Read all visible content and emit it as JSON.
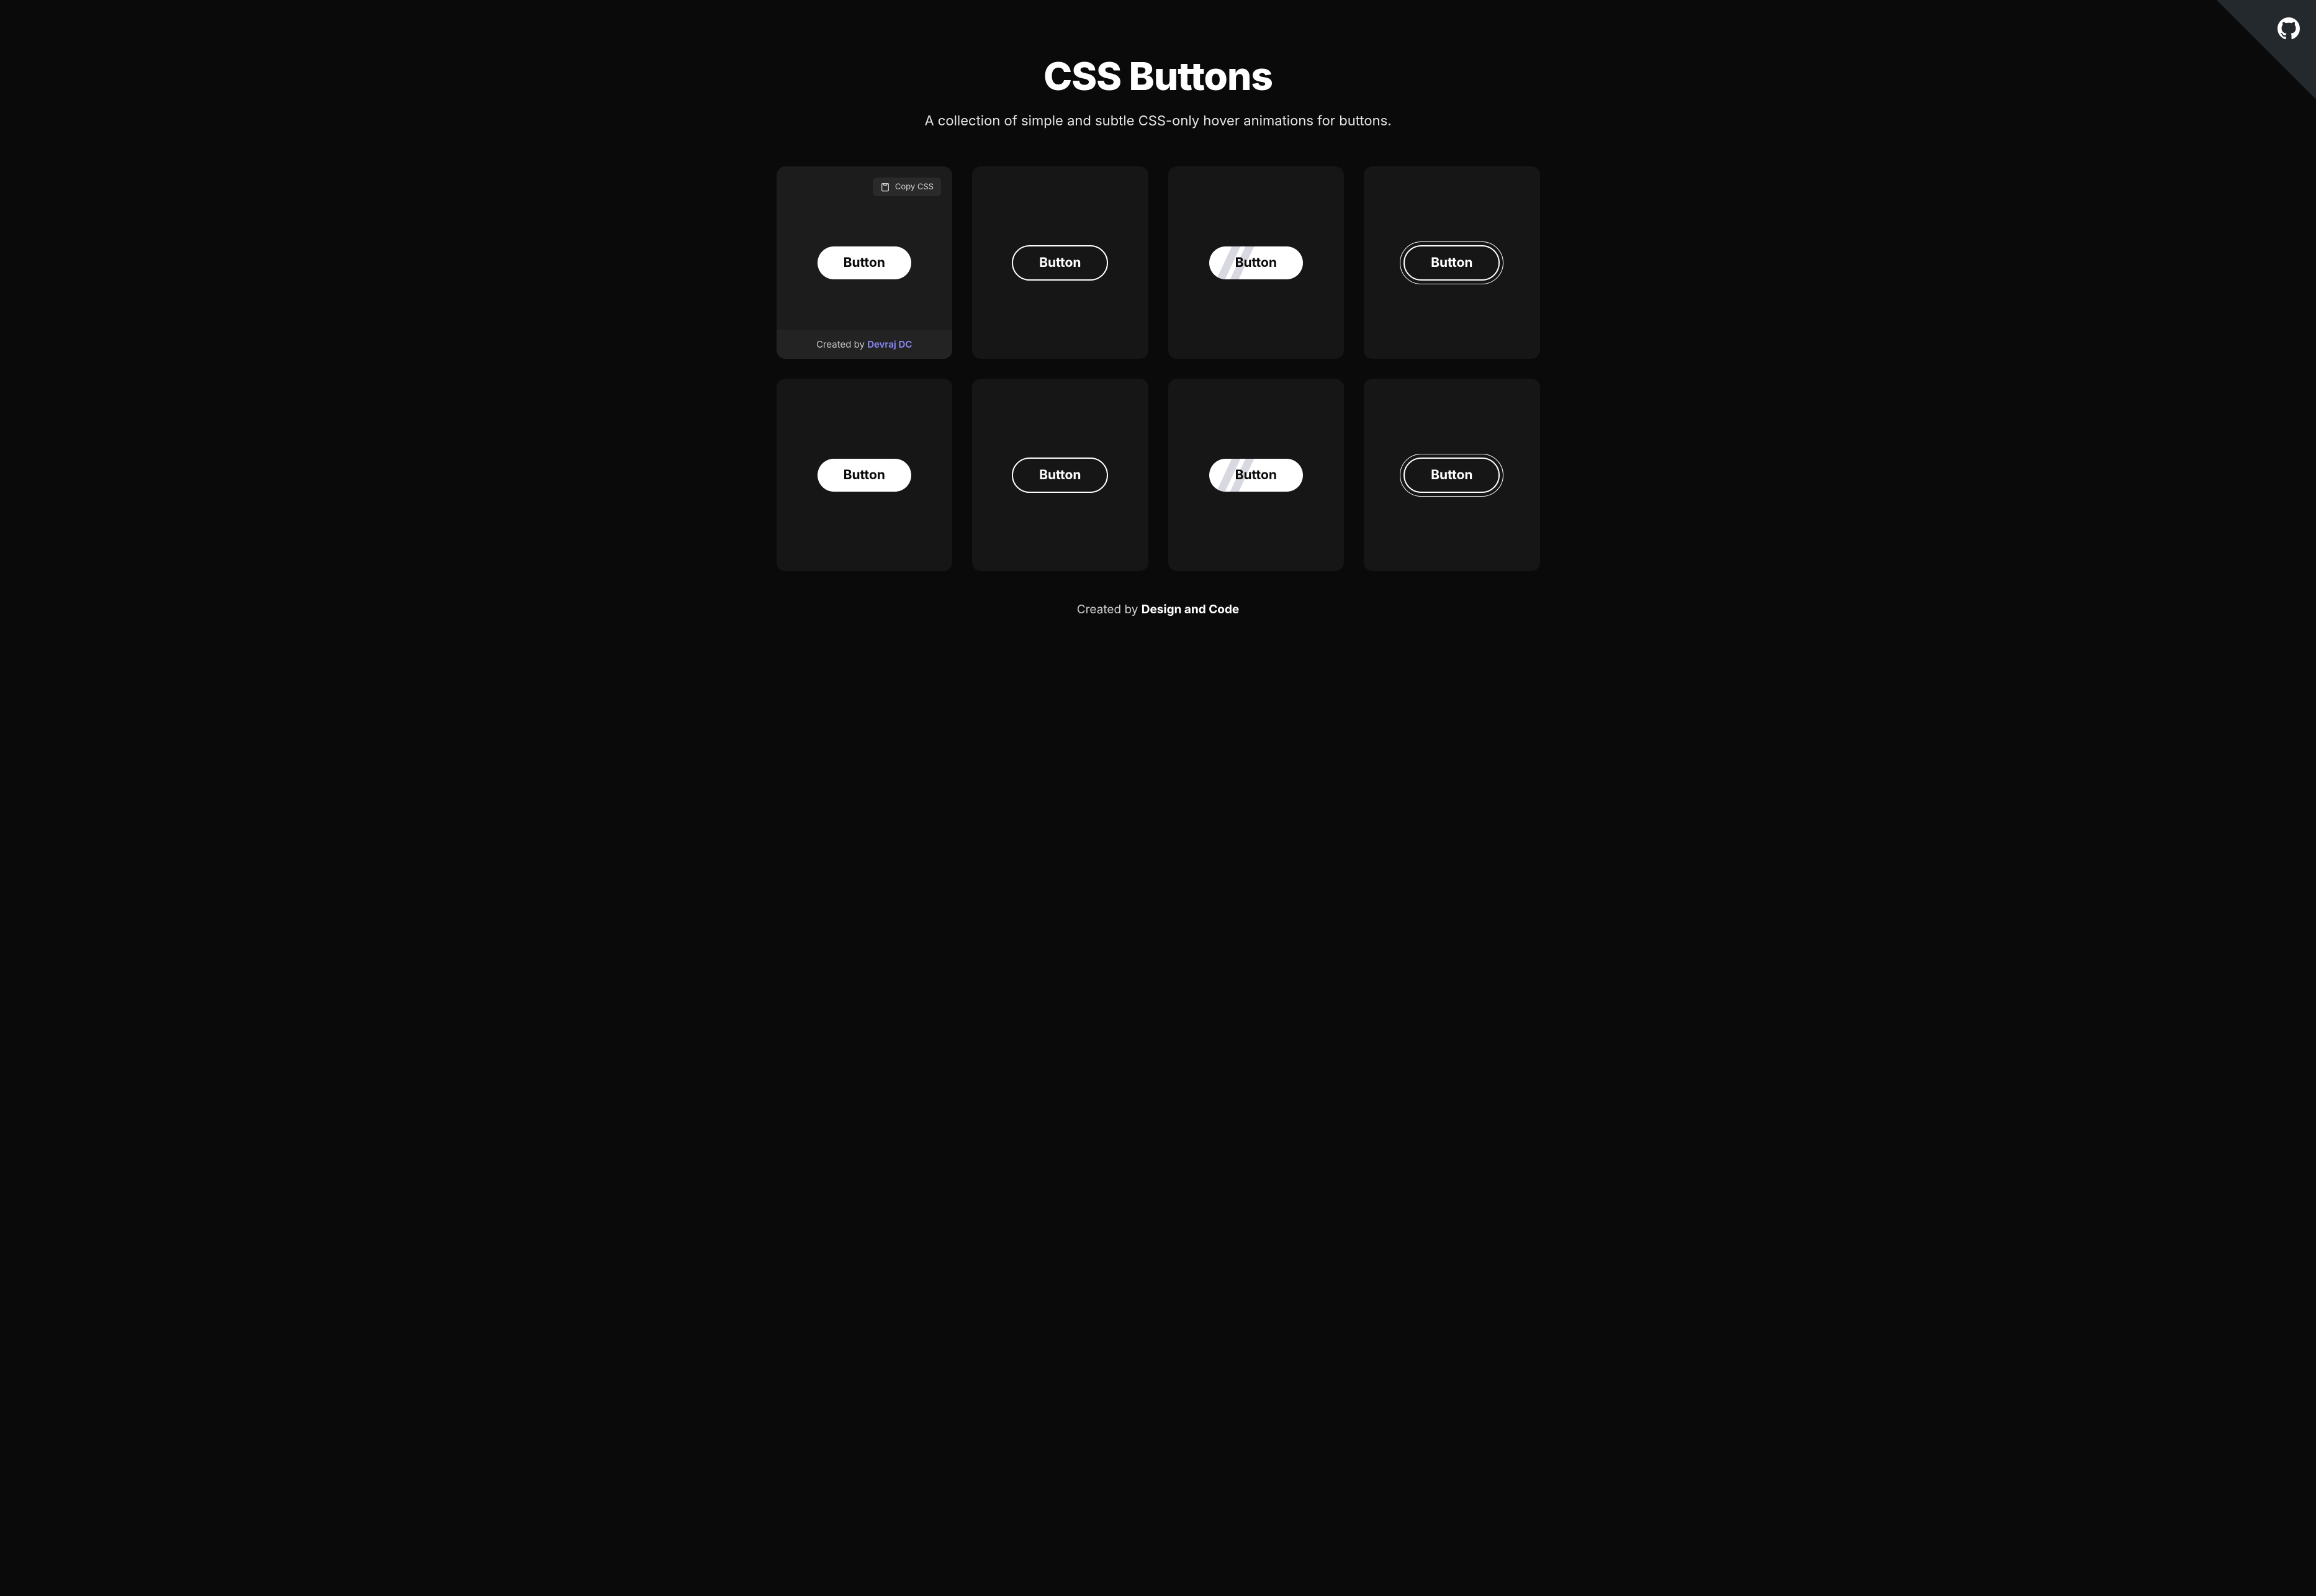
{
  "header": {
    "title": "CSS Buttons",
    "subtitle": "A collection of simple and subtle CSS-only hover animations for buttons."
  },
  "github": {
    "label": "GitHub"
  },
  "copy": {
    "label": "Copy CSS"
  },
  "card_footer": {
    "created_by": "Created by ",
    "author": "Devraj DC"
  },
  "buttons": {
    "b1": "Button",
    "b2": "Button",
    "b3": "Button",
    "b4": "Button",
    "b5": "Button",
    "b6": "Button",
    "b7": "Button",
    "b8": "Button"
  },
  "footer": {
    "created": "Created by ",
    "brand": "Design and Code"
  }
}
